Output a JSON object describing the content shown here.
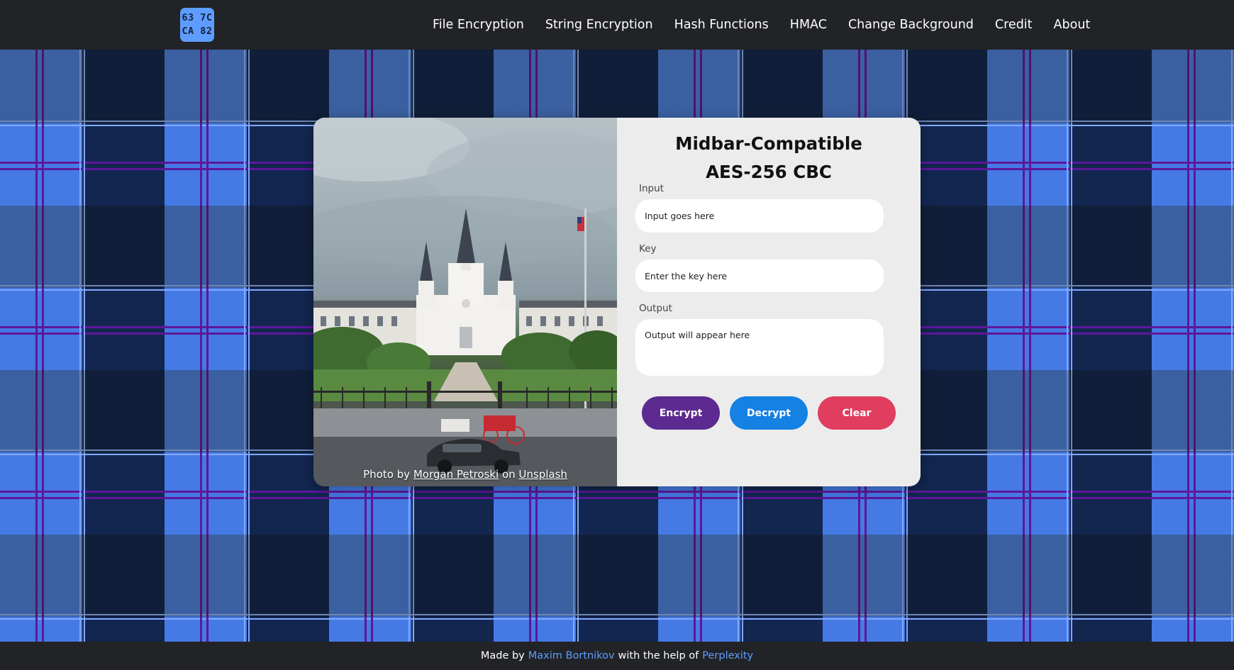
{
  "logo": {
    "line1": "63 7C",
    "line2": "CA 82"
  },
  "nav": {
    "items": [
      {
        "label": "File Encryption"
      },
      {
        "label": "String Encryption"
      },
      {
        "label": "Hash Functions"
      },
      {
        "label": "HMAC"
      },
      {
        "label": "Change Background"
      },
      {
        "label": "Credit"
      },
      {
        "label": "About"
      }
    ]
  },
  "colors": {
    "navbar": "#212326",
    "accent_blue": "#5e9dff",
    "encrypt": "#5d2a91",
    "decrypt": "#1481e3",
    "clear": "#e03d5f",
    "plaid_light": "#66a2ff",
    "plaid_dark": "#1b2a48",
    "plaid_stripe": "#7a1a9a"
  },
  "card": {
    "title_line1": "Midbar-Compatible",
    "title_line2": "AES-256 CBC",
    "photo_credit": {
      "prefix": "Photo by",
      "author": "Morgan Petroski",
      "middle": "on",
      "site": "Unsplash"
    },
    "input": {
      "label": "Input",
      "placeholder": "Input goes here",
      "value": ""
    },
    "key": {
      "label": "Key",
      "placeholder": "Enter the key here",
      "value": ""
    },
    "output": {
      "label": "Output",
      "placeholder": "Output will appear here",
      "value": ""
    },
    "buttons": {
      "encrypt": "Encrypt",
      "decrypt": "Decrypt",
      "clear": "Clear"
    }
  },
  "footer": {
    "prefix": "Made by",
    "author": "Maxim Bortnikov",
    "middle": "with the help of",
    "tool": "Perplexity"
  }
}
